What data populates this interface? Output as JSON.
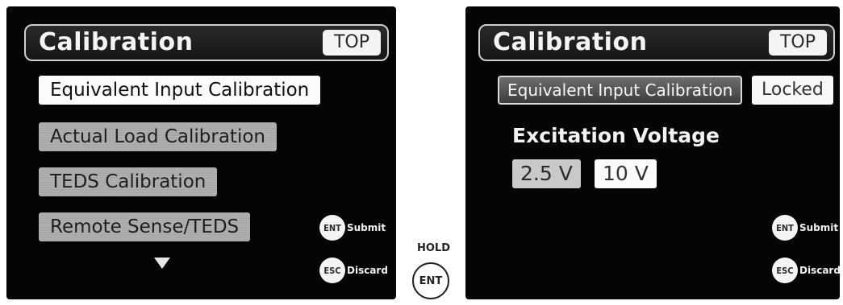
{
  "left_screen": {
    "title": "Calibration",
    "top_label": "TOP",
    "menu_items": [
      {
        "label": "Equivalent Input Calibration",
        "selected": true
      },
      {
        "label": "Actual Load Calibration",
        "selected": false
      },
      {
        "label": "TEDS Calibration",
        "selected": false
      },
      {
        "label": "Remote Sense/TEDS",
        "selected": false
      }
    ],
    "keys": [
      {
        "key": "ENT",
        "label": "Submit"
      },
      {
        "key": "ESC",
        "label": "Discard"
      }
    ]
  },
  "hold_hint": {
    "label": "HOLD",
    "key": "ENT"
  },
  "right_screen": {
    "title": "Calibration",
    "top_label": "TOP",
    "mode_label": "Equivalent Input Calibration",
    "status_label": "Locked",
    "section_label": "Excitation Voltage",
    "options": [
      {
        "label": "2.5 V",
        "selected": false
      },
      {
        "label": "10 V",
        "selected": true
      }
    ],
    "keys": [
      {
        "key": "ENT",
        "label": "Submit"
      },
      {
        "key": "ESC",
        "label": "Discard"
      }
    ]
  }
}
